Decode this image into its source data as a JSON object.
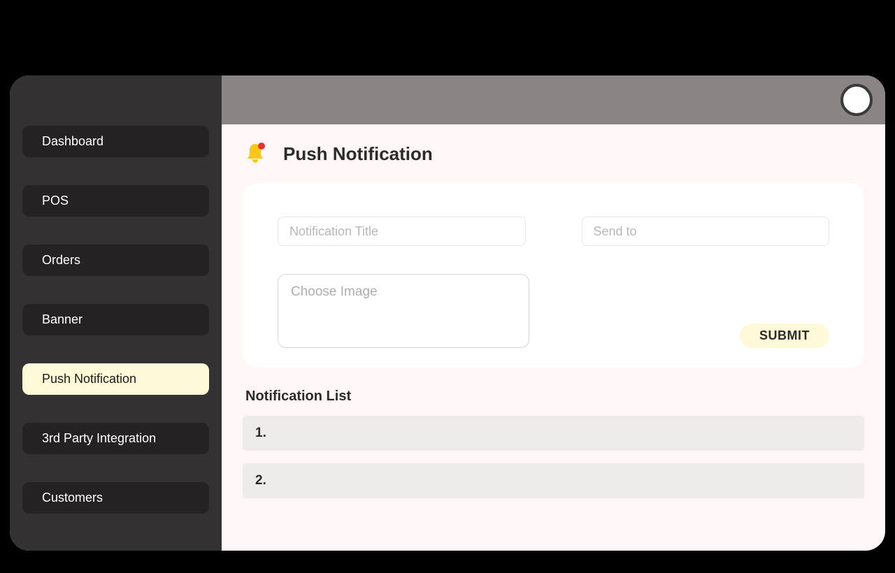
{
  "sidebar": {
    "items": [
      {
        "label": "Dashboard"
      },
      {
        "label": "POS"
      },
      {
        "label": "Orders"
      },
      {
        "label": "Banner"
      },
      {
        "label": "Push Notification"
      },
      {
        "label": "3rd Party Integration"
      },
      {
        "label": "Customers"
      }
    ],
    "activeIndex": 4
  },
  "page": {
    "title": "Push Notification"
  },
  "form": {
    "title_placeholder": "Notification Title",
    "sendto_placeholder": "Send to",
    "choose_image_label": "Choose Image",
    "submit_label": "SUBMIT"
  },
  "list": {
    "title": "Notification List",
    "items": [
      {
        "label": "1."
      },
      {
        "label": "2."
      }
    ]
  }
}
